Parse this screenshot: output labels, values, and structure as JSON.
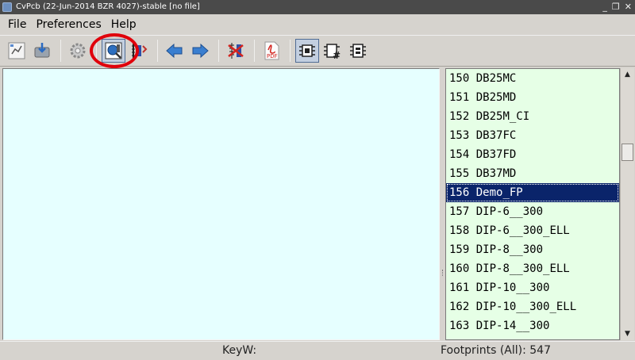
{
  "window": {
    "title": "CvPcb (22-Jun-2014 BZR 4027)-stable  [no file]"
  },
  "menu": [
    "File",
    "Preferences",
    "Help"
  ],
  "toolbar": [
    {
      "name": "save-netlist-icon"
    },
    {
      "name": "save-to-file-icon"
    },
    {
      "name": "settings-gear-icon"
    },
    {
      "name": "display-footprint-icon"
    },
    {
      "name": "select-component-icon"
    },
    {
      "name": "previous-arrow-icon"
    },
    {
      "name": "next-arrow-icon"
    },
    {
      "name": "delete-associations-icon"
    },
    {
      "name": "pdf-datasheet-icon"
    },
    {
      "name": "filter-by-keyword-icon"
    },
    {
      "name": "filter-by-pin-count-icon"
    },
    {
      "name": "filter-by-library-icon"
    }
  ],
  "footprints": [
    {
      "num": "150",
      "name": "DB25MC",
      "selected": false
    },
    {
      "num": "151",
      "name": "DB25MD",
      "selected": false
    },
    {
      "num": "152",
      "name": "DB25M_CI",
      "selected": false
    },
    {
      "num": "153",
      "name": "DB37FC",
      "selected": false
    },
    {
      "num": "154",
      "name": "DB37FD",
      "selected": false
    },
    {
      "num": "155",
      "name": "DB37MD",
      "selected": false
    },
    {
      "num": "156",
      "name": "Demo_FP",
      "selected": true
    },
    {
      "num": "157",
      "name": "DIP-6__300",
      "selected": false
    },
    {
      "num": "158",
      "name": "DIP-6__300_ELL",
      "selected": false
    },
    {
      "num": "159",
      "name": "DIP-8__300",
      "selected": false
    },
    {
      "num": "160",
      "name": "DIP-8__300_ELL",
      "selected": false
    },
    {
      "num": "161",
      "name": "DIP-10__300",
      "selected": false
    },
    {
      "num": "162",
      "name": "DIP-10__300_ELL",
      "selected": false
    },
    {
      "num": "163",
      "name": "DIP-14__300",
      "selected": false
    }
  ],
  "status": {
    "keyword": "KeyW:",
    "count": "Footprints (All): 547"
  },
  "colors": {
    "left_pane": "#e6ffff",
    "right_pane": "#e6ffe6",
    "selection": "#0a246a",
    "highlight_ring": "#e0000b"
  }
}
